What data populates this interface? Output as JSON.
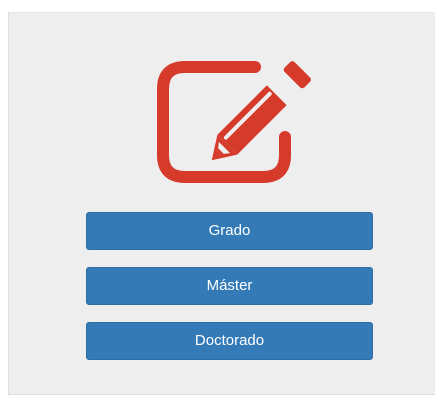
{
  "icon": {
    "name": "edit-pencil-square-icon",
    "color": "#d63a2b"
  },
  "buttons": [
    {
      "label": "Grado"
    },
    {
      "label": "Máster"
    },
    {
      "label": "Doctorado"
    }
  ],
  "colors": {
    "button_bg": "#337ab7",
    "panel_bg": "#eeeeee"
  }
}
